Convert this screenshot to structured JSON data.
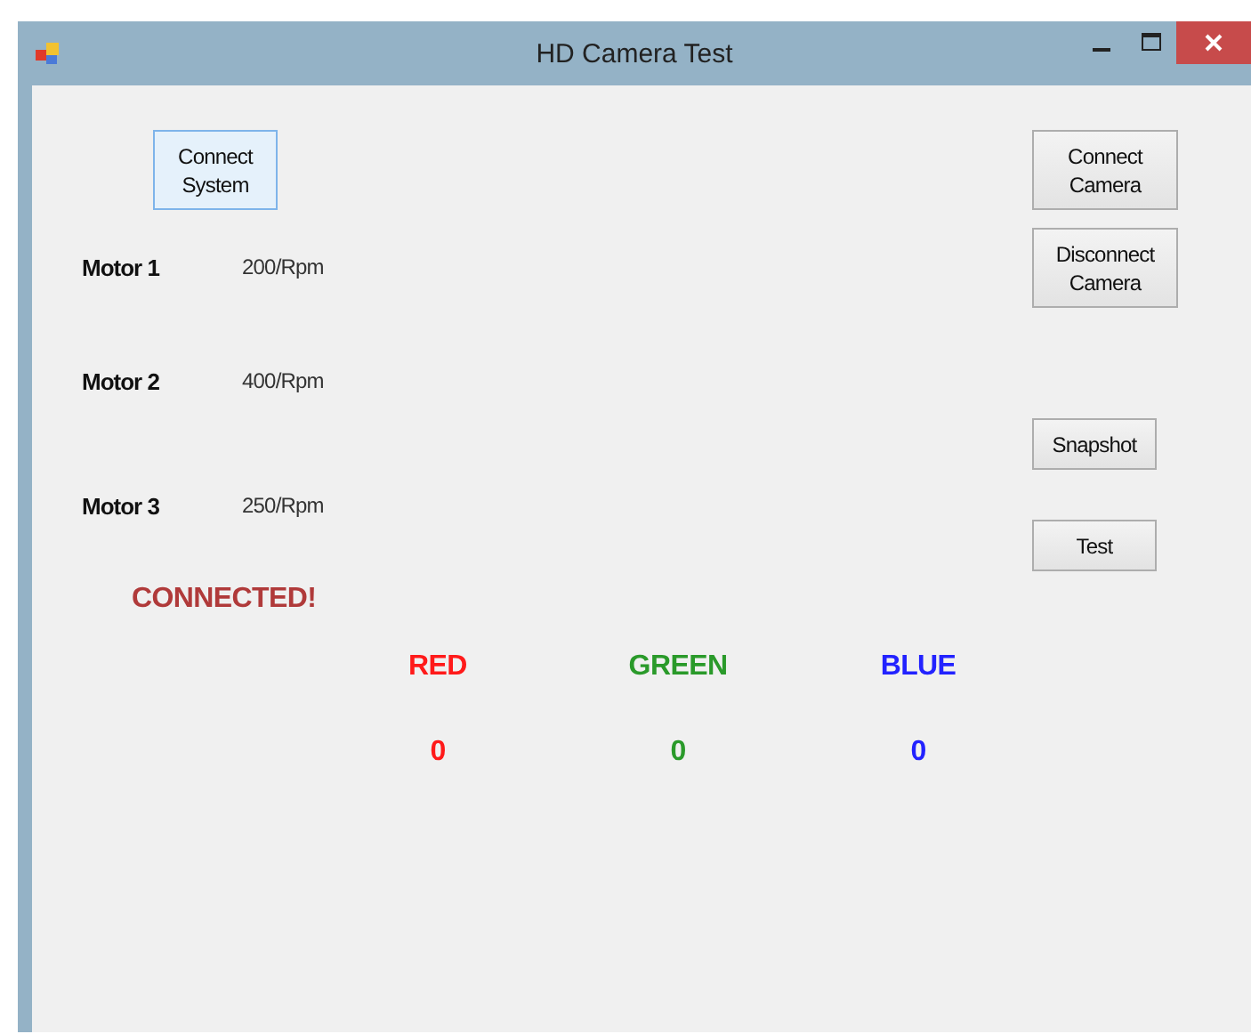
{
  "window": {
    "title": "HD Camera Test"
  },
  "connect_system_button": {
    "label": "Connect\nSystem",
    "focused": true
  },
  "motors": [
    {
      "name": "Motor 1",
      "speed": "200/Rpm"
    },
    {
      "name": "Motor 2",
      "speed": "400/Rpm"
    },
    {
      "name": "Motor 3",
      "speed": "250/Rpm"
    }
  ],
  "status": {
    "text": "CONNECTED!"
  },
  "channels": [
    {
      "name": "RED",
      "value": "0",
      "color": "#ff1a1a"
    },
    {
      "name": "GREEN",
      "value": "0",
      "color": "#2a9a2a"
    },
    {
      "name": "BLUE",
      "value": "0",
      "color": "#2222ff"
    }
  ],
  "right_buttons": [
    {
      "label": "Connect\nCamera",
      "kind": "wide"
    },
    {
      "label": "Disconnect\nCamera",
      "kind": "wide"
    },
    {
      "label": "Snapshot",
      "kind": "narrow"
    },
    {
      "label": "Test",
      "kind": "narrow"
    }
  ]
}
